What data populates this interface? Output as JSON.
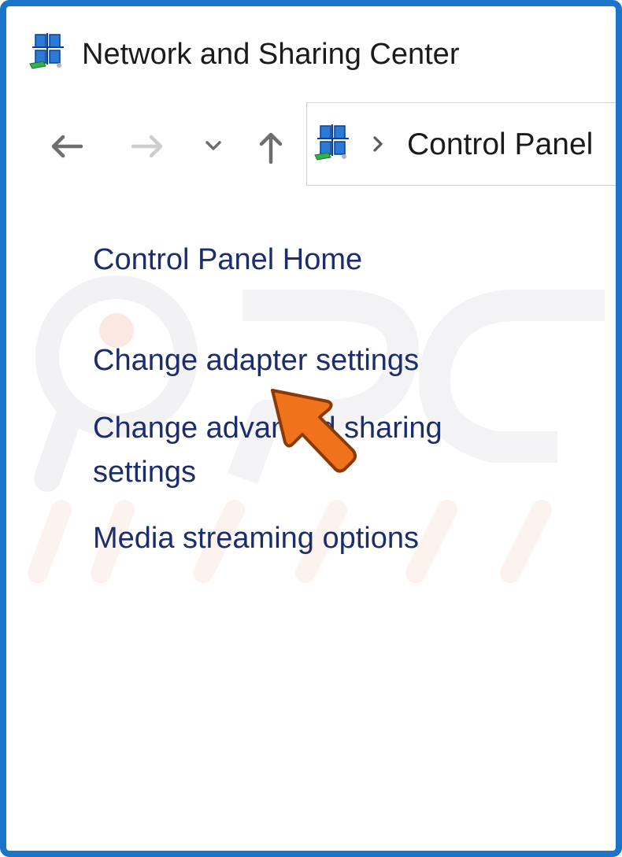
{
  "window": {
    "title": "Network and Sharing Center",
    "icon": "network-sharing-icon",
    "border_color": "#1a74c8"
  },
  "nav": {
    "back_icon": "arrow-left-icon",
    "forward_icon": "arrow-right-icon",
    "recent_icon": "chevron-down-icon",
    "up_icon": "arrow-up-icon"
  },
  "address": {
    "icon": "network-sharing-icon",
    "separator_icon": "chevron-right-icon",
    "breadcrumb": "Control Panel"
  },
  "sidebar": {
    "items": [
      {
        "label": "Control Panel Home"
      },
      {
        "label": "Change adapter settings"
      },
      {
        "label": "Change advanced sharing"
      },
      {
        "label": "settings"
      },
      {
        "label": "Media streaming options"
      }
    ]
  },
  "annotation": {
    "icon": "pointer-arrow-icon",
    "color": "#f0731c"
  },
  "colors": {
    "link": "#1c2d6b",
    "text": "#1b1b1b"
  }
}
